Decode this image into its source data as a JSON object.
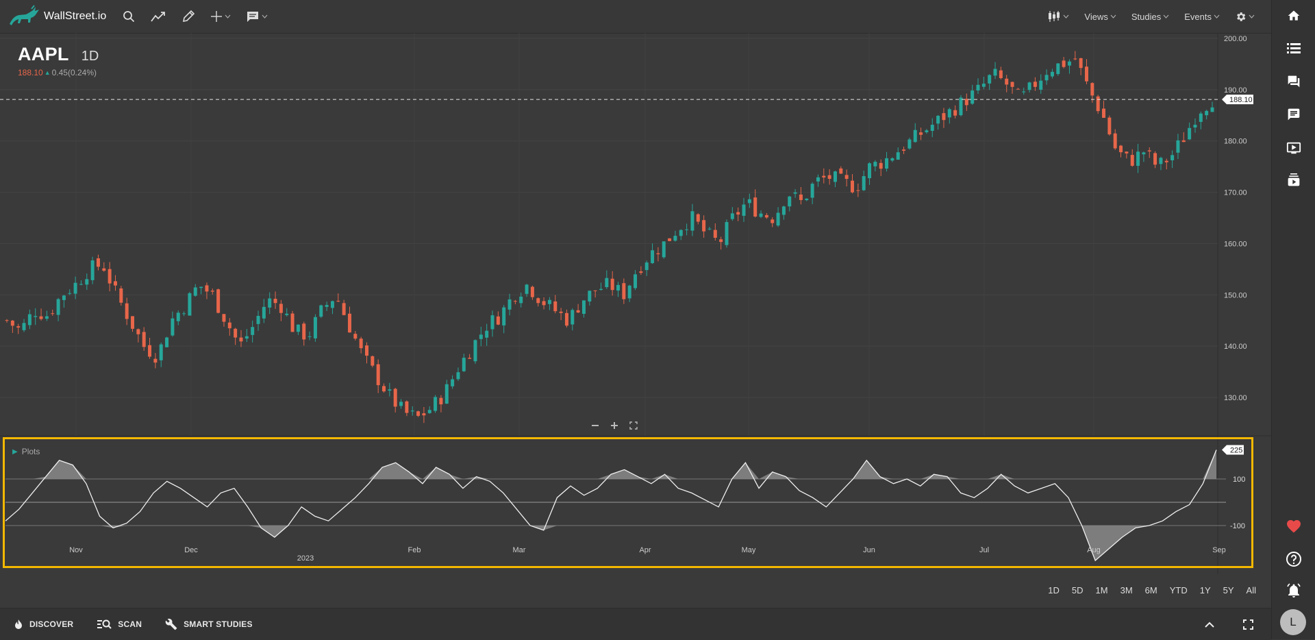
{
  "app": {
    "name": "WallStreet.io"
  },
  "symbol": {
    "ticker": "AAPL",
    "interval": "1D",
    "price": "188.10",
    "change": "0.45(0.24%)"
  },
  "colors": {
    "up": "#26a69a",
    "down": "#e8664a",
    "panel_highlight": "#f5b800"
  },
  "toolbar": {
    "left_icons": [
      "search-icon",
      "trend-line-icon",
      "pencil-icon",
      "crosshair-icon",
      "comment-icon"
    ],
    "right_items": [
      "Views",
      "Studies",
      "Events"
    ]
  },
  "sidebar": {
    "icons": [
      "home-icon",
      "list-icon",
      "chat-icon",
      "message-icon",
      "tv-icon",
      "stack-icon",
      "heart-icon",
      "help-icon",
      "bell-icon"
    ],
    "avatar": "L"
  },
  "price_axis": {
    "labels": [
      "200.00",
      "190.00",
      "180.00",
      "170.00",
      "160.00",
      "150.00",
      "140.00",
      "130.00"
    ],
    "current": "188.10"
  },
  "plots": {
    "label": "Plots",
    "current_value": "225",
    "levels": [
      "100",
      "-100"
    ]
  },
  "time_axis": {
    "months": [
      "Nov",
      "Dec",
      "Feb",
      "Mar",
      "Apr",
      "May",
      "Jun",
      "Jul",
      "Aug",
      "Sep"
    ],
    "year_label": "2023"
  },
  "ranges": [
    "1D",
    "5D",
    "1M",
    "3M",
    "6M",
    "YTD",
    "1Y",
    "5Y",
    "All"
  ],
  "bottombar": {
    "discover": "DISCOVER",
    "scan": "SCAN",
    "smart_studies": "SMART STUDIES"
  },
  "chart_data": {
    "type": "candlestick",
    "y_range": [
      125,
      200
    ],
    "y_ticks": [
      130,
      140,
      150,
      160,
      170,
      180,
      190,
      200
    ],
    "last_price": 188.1,
    "close_path": [
      145,
      143,
      147,
      146,
      150,
      152,
      155,
      156,
      150,
      145,
      140,
      138,
      145,
      148,
      152,
      150,
      145,
      140,
      144,
      149,
      148,
      143,
      142,
      147,
      150,
      144,
      138,
      134,
      130,
      127,
      126,
      128,
      131,
      136,
      140,
      144,
      146,
      150,
      152,
      149,
      147,
      145,
      149,
      151,
      152,
      150,
      155,
      158,
      160,
      163,
      165,
      162,
      160,
      165,
      168,
      166,
      165,
      170,
      168,
      172,
      173,
      172,
      171,
      175,
      176,
      178,
      180,
      182,
      184,
      186,
      188,
      190,
      193,
      191,
      188,
      191,
      194,
      195,
      196,
      190,
      185,
      178,
      176,
      178,
      175,
      177,
      181,
      186,
      188.1
    ],
    "oscillator": {
      "type": "area",
      "levels": [
        100,
        -100
      ],
      "range": [
        -250,
        250
      ],
      "last_value": 225,
      "values": [
        -80,
        -30,
        40,
        110,
        180,
        160,
        80,
        -60,
        -110,
        -90,
        -40,
        40,
        90,
        60,
        20,
        -20,
        40,
        60,
        -20,
        -110,
        -150,
        -100,
        -20,
        -60,
        -80,
        -30,
        20,
        80,
        150,
        170,
        130,
        80,
        150,
        120,
        60,
        110,
        90,
        40,
        -30,
        -100,
        -120,
        20,
        70,
        30,
        60,
        120,
        140,
        110,
        80,
        120,
        60,
        40,
        10,
        -20,
        100,
        170,
        60,
        130,
        110,
        50,
        20,
        -20,
        40,
        100,
        180,
        110,
        80,
        100,
        70,
        120,
        110,
        40,
        20,
        60,
        120,
        70,
        40,
        60,
        80,
        20,
        -100,
        -250,
        -200,
        -150,
        -110,
        -100,
        -80,
        -40,
        -10,
        80,
        225
      ]
    }
  }
}
